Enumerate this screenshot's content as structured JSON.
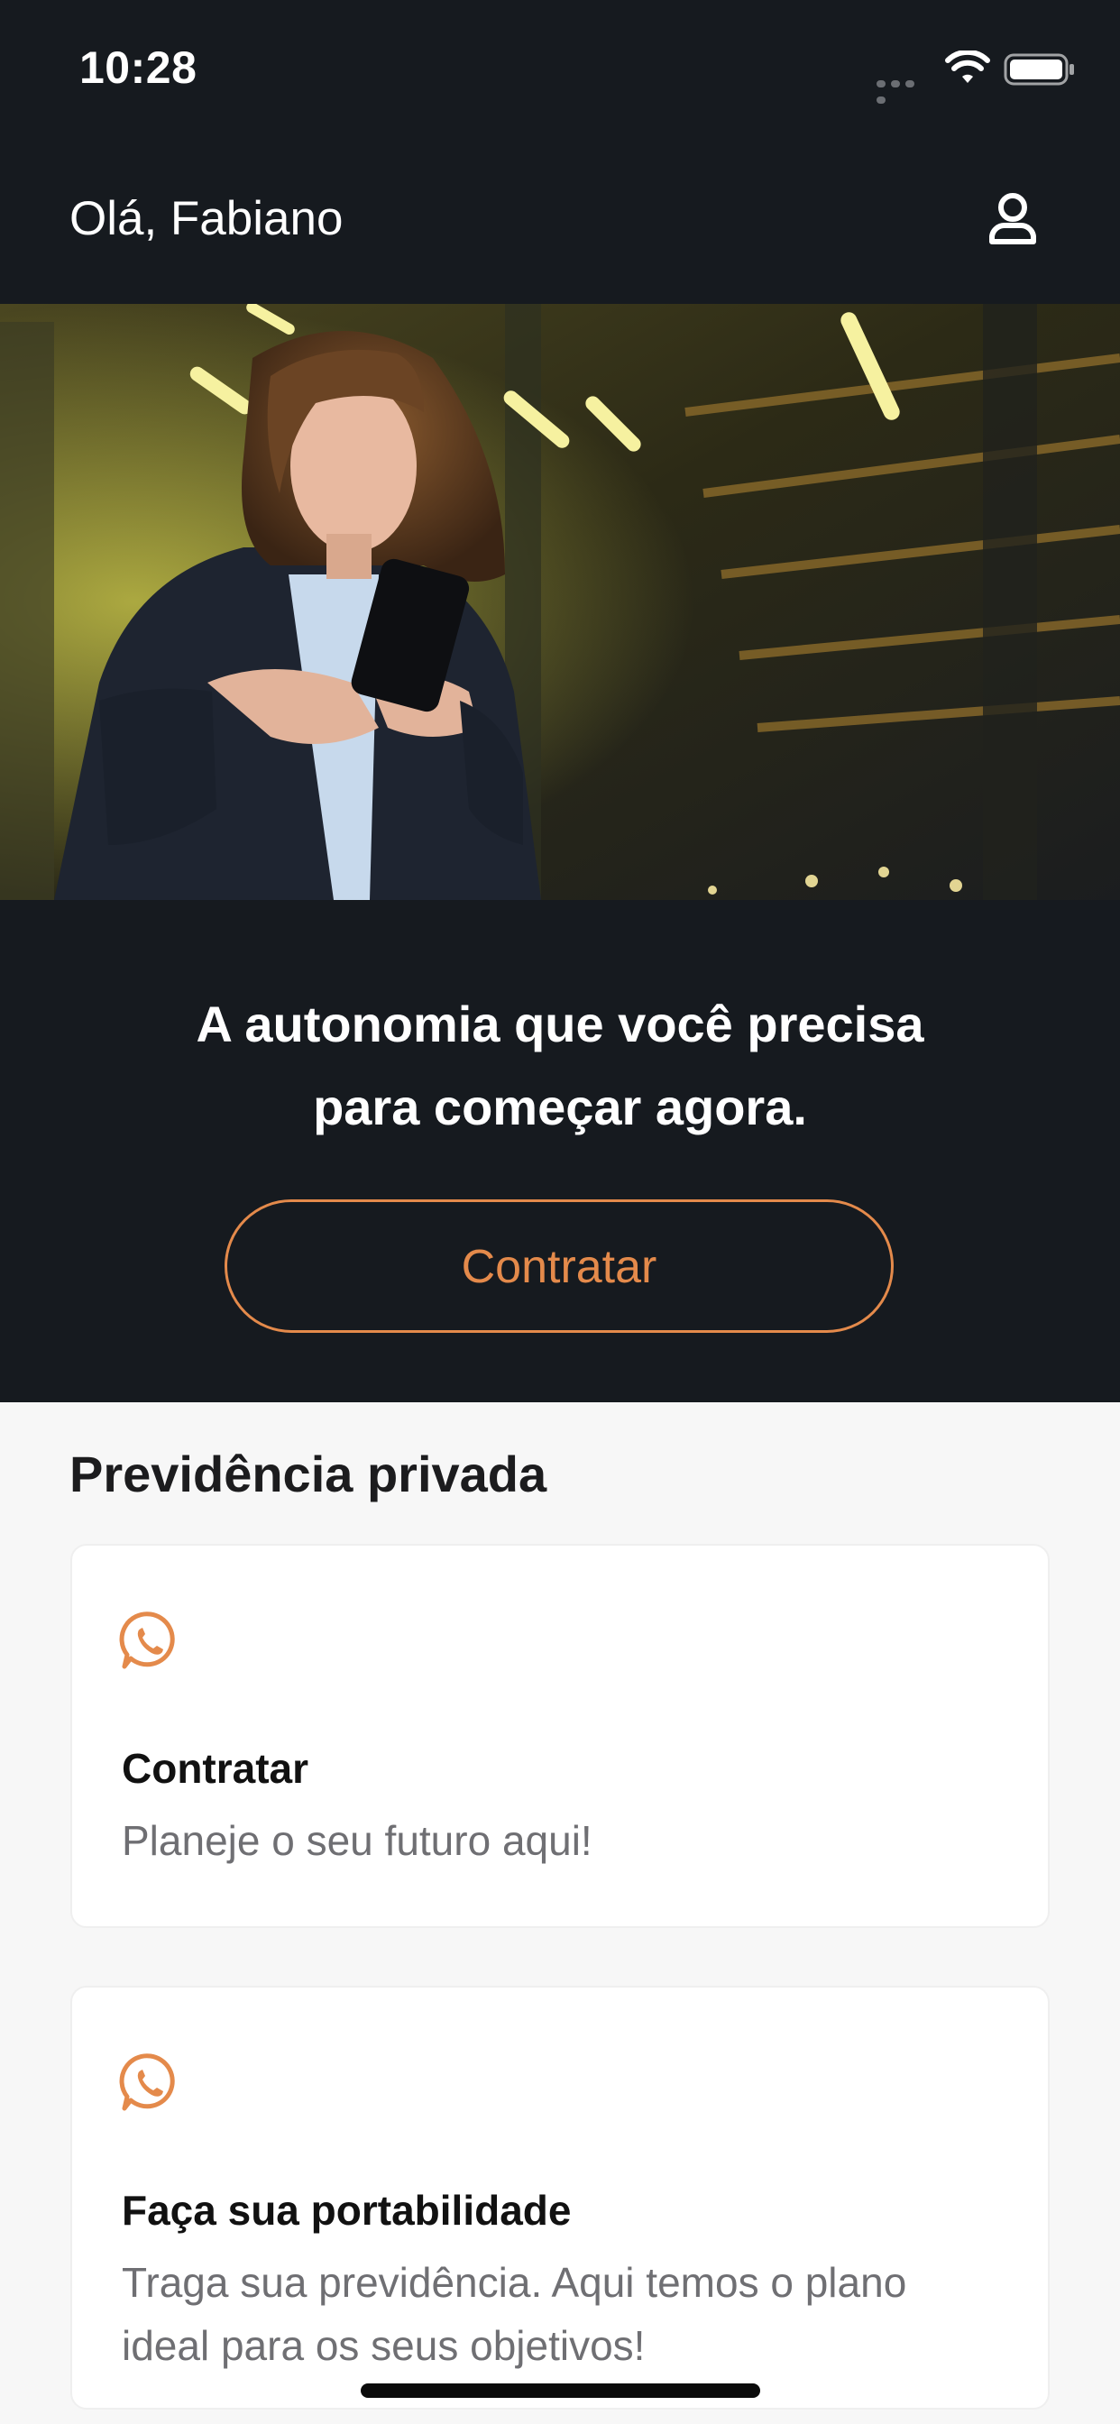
{
  "status_bar": {
    "time": "10:28",
    "icons": [
      "signal-icon",
      "wifi-icon",
      "battery-icon"
    ]
  },
  "header": {
    "greeting": "Olá, Fabiano",
    "profile_icon": "user-icon"
  },
  "hero": {
    "image": "woman-using-phone-photo"
  },
  "promo": {
    "line1": "A autonomia que você precisa",
    "line2": "para começar agora.",
    "button_label": "Contratar"
  },
  "section": {
    "title": "Previdência privada",
    "cards": [
      {
        "icon": "whatsapp-icon",
        "title": "Contratar",
        "description": "Planeje o seu futuro aqui!"
      },
      {
        "icon": "whatsapp-icon",
        "title": "Faça sua portabilidade",
        "description": "Traga sua previdência. Aqui temos o plano ideal para os seus objetivos!"
      }
    ]
  },
  "colors": {
    "dark_background": "#161a1f",
    "accent": "#e48a4b",
    "light_background": "#f7f7f7"
  }
}
